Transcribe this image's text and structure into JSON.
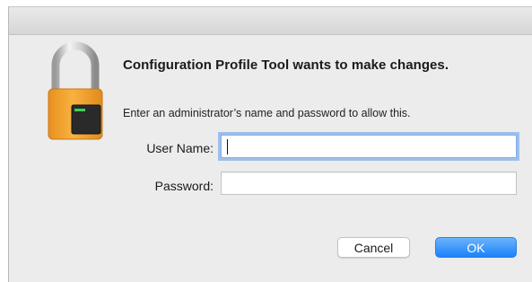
{
  "dialog": {
    "title": "Configuration Profile Tool wants to make changes.",
    "message": "Enter an administrator’s name and password to allow this.",
    "icon": "lock-icon"
  },
  "fields": {
    "username_label": "User Name:",
    "username_value": "",
    "password_label": "Password:",
    "password_value": ""
  },
  "buttons": {
    "cancel_label": "Cancel",
    "ok_label": "OK"
  },
  "colors": {
    "accent": "#1a82fb",
    "focus_ring": "#5e9be9",
    "lock_body": "#f0a830",
    "dialog_bg": "#ececec"
  }
}
